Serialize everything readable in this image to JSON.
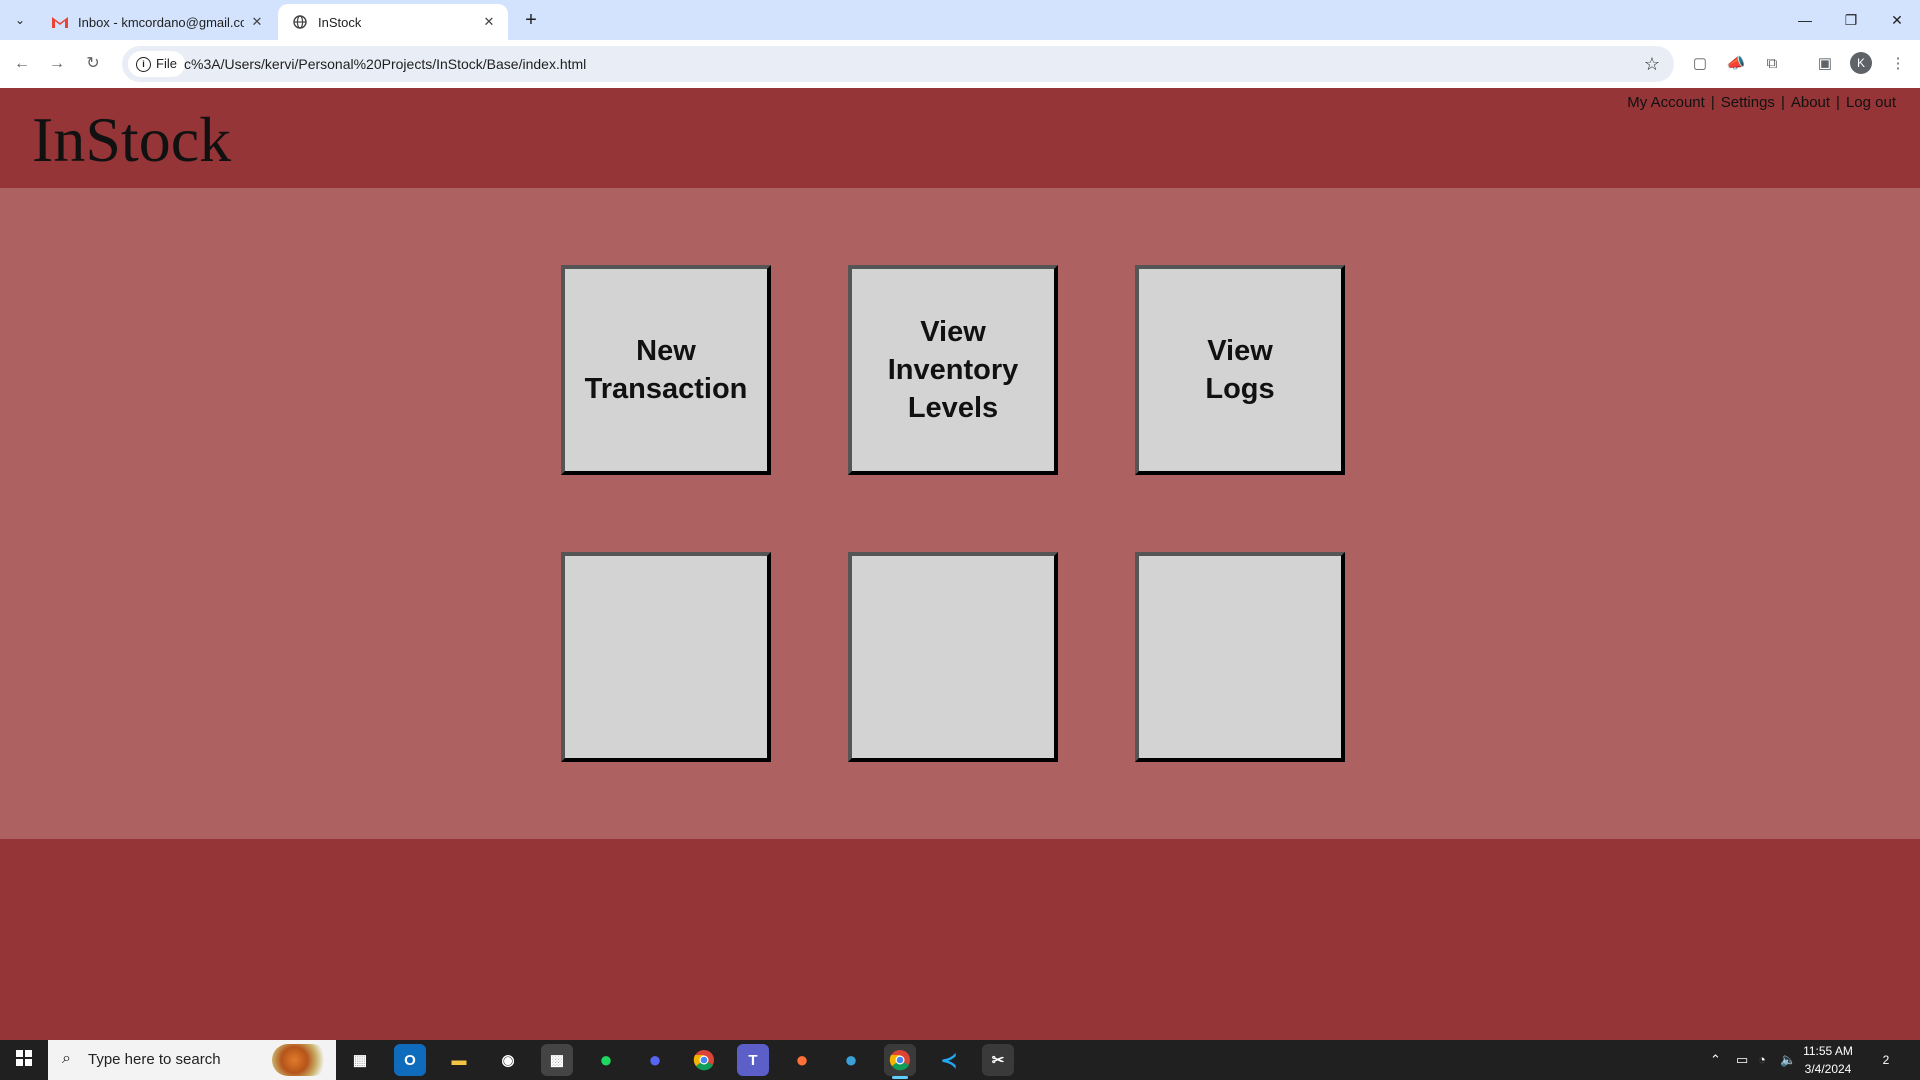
{
  "browser": {
    "tabs": [
      {
        "title": "Inbox - kmcordano@gmail.com",
        "icon": "gmail-icon"
      },
      {
        "title": "InStock",
        "icon": "globe-icon"
      }
    ],
    "new_tab": "+",
    "url_chip": "File",
    "url": "c%3A/Users/kervi/Personal%20Projects/InStock/Base/index.html",
    "profile_initial": "K"
  },
  "app": {
    "logo": "InStock",
    "nav": [
      {
        "label": "My Account"
      },
      {
        "label": "Settings"
      },
      {
        "label": "About"
      },
      {
        "label": "Log out"
      }
    ],
    "separator": "|",
    "tiles": [
      {
        "lines": [
          "New",
          "Transaction"
        ]
      },
      {
        "lines": [
          "View",
          "Inventory",
          "Levels"
        ]
      },
      {
        "lines": [
          "View",
          "Logs"
        ]
      },
      {
        "lines": []
      },
      {
        "lines": []
      },
      {
        "lines": []
      }
    ],
    "colors": {
      "header": "#953537",
      "main": "#ad6161",
      "tile": "#d3d3d3"
    }
  },
  "taskbar": {
    "search_placeholder": "Type here to search",
    "time": "11:55 AM",
    "date": "3/4/2024",
    "notifications": "2"
  }
}
